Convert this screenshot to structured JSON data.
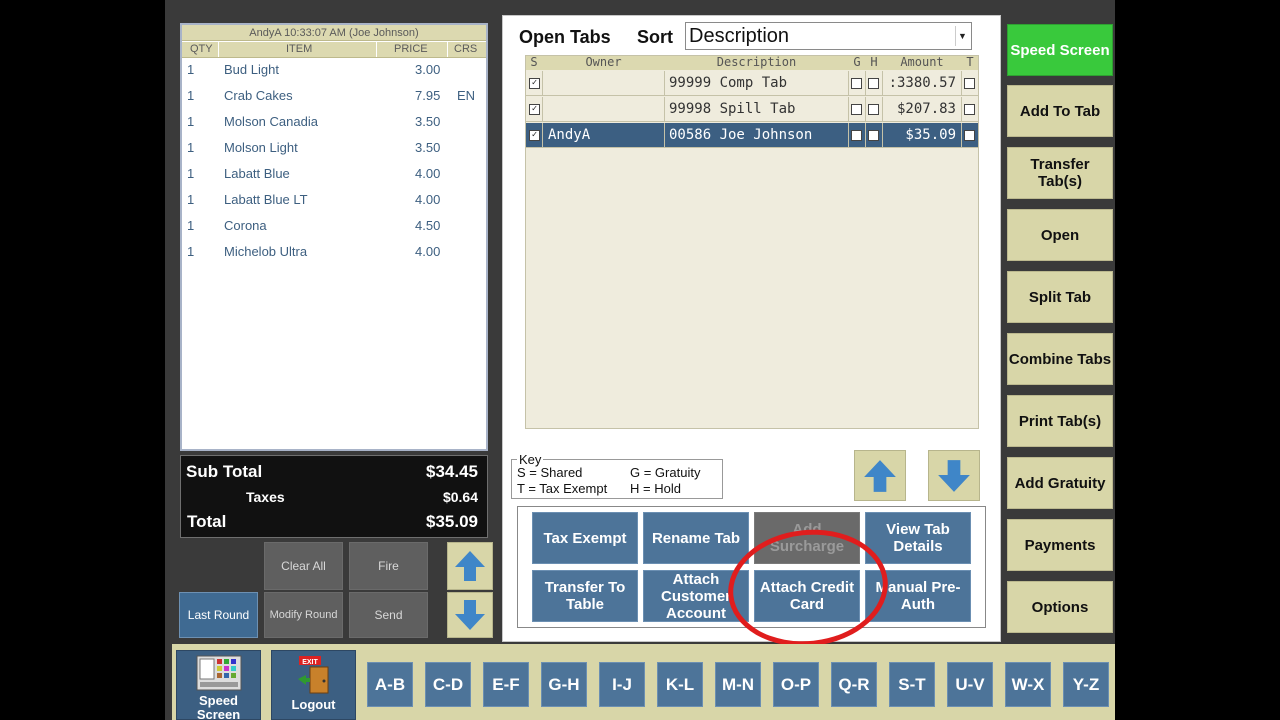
{
  "receipt": {
    "header": "AndyA  10:33:07 AM  (Joe Johnson)",
    "columns": {
      "qty": "QTY",
      "item": "ITEM",
      "price": "PRICE",
      "crs": "CRS"
    },
    "items": [
      {
        "qty": "1",
        "item": "Bud Light",
        "price": "3.00",
        "crs": ""
      },
      {
        "qty": "1",
        "item": "Crab Cakes",
        "price": "7.95",
        "crs": "EN"
      },
      {
        "qty": "1",
        "item": "Molson Canadia",
        "price": "3.50",
        "crs": ""
      },
      {
        "qty": "1",
        "item": "Molson Light",
        "price": "3.50",
        "crs": ""
      },
      {
        "qty": "1",
        "item": "Labatt Blue",
        "price": "4.00",
        "crs": ""
      },
      {
        "qty": "1",
        "item": "Labatt Blue LT",
        "price": "4.00",
        "crs": ""
      },
      {
        "qty": "1",
        "item": "Corona",
        "price": "4.50",
        "crs": ""
      },
      {
        "qty": "1",
        "item": "Michelob Ultra",
        "price": "4.00",
        "crs": ""
      }
    ]
  },
  "totals": {
    "subtotal_label": "Sub Total",
    "subtotal": "$34.45",
    "taxes_label": "Taxes",
    "taxes": "$0.64",
    "total_label": "Total",
    "total": "$35.09"
  },
  "round_buttons": {
    "clear_all": "Clear All",
    "fire": "Fire",
    "last_round": "Last Round",
    "modify_round": "Modify Round",
    "send": "Send"
  },
  "open_tabs": {
    "title": "Open Tabs",
    "sort_label": "Sort",
    "sort_value": "Description",
    "columns": {
      "s": "S",
      "owner": "Owner",
      "description": "Description",
      "g": "G",
      "h": "H",
      "amount": "Amount",
      "t": "T"
    },
    "rows": [
      {
        "shared": "✓",
        "owner": "",
        "description": "99999 Comp Tab",
        "amount": ":3380.57",
        "selected": false
      },
      {
        "shared": "✓",
        "owner": "",
        "description": "99998 Spill Tab",
        "amount": "$207.83",
        "selected": false
      },
      {
        "shared": "✓",
        "owner": "AndyA",
        "description": "00586 Joe Johnson",
        "amount": "$35.09",
        "selected": true
      }
    ]
  },
  "key": {
    "title": "Key",
    "shared": "S = Shared",
    "gratuity": "G = Gratuity",
    "tax_exempt": "T = Tax Exempt",
    "hold": "H = Hold"
  },
  "actions": {
    "tax_exempt": "Tax Exempt",
    "rename_tab": "Rename Tab",
    "add_surcharge": "Add Surcharge",
    "view_tab_details": "View Tab Details",
    "transfer_to_table": "Transfer To Table",
    "attach_customer_account": "Attach Customer Account",
    "attach_credit_card": "Attach Credit Card",
    "manual_preauth": "Manual Pre-Auth"
  },
  "right_menu": {
    "speed_screen": "Speed Screen",
    "add_to_tab": "Add To Tab",
    "transfer_tabs": "Transfer Tab(s)",
    "open": "Open",
    "split_tab": "Split Tab",
    "combine_tabs": "Combine Tabs",
    "print_tabs": "Print Tab(s)",
    "add_gratuity": "Add Gratuity",
    "payments": "Payments",
    "options": "Options"
  },
  "bottom": {
    "speed_screen": "Speed Screen",
    "logout": "Logout",
    "exit_sign": "EXIT",
    "letters": [
      "A-B",
      "C-D",
      "E-F",
      "G-H",
      "I-J",
      "K-L",
      "M-N",
      "O-P",
      "Q-R",
      "S-T",
      "U-V",
      "W-X",
      "Y-Z"
    ]
  },
  "colors": {
    "accent_blue": "#4d7499",
    "khaki": "#d8d6a8",
    "green": "#39c93c",
    "annotation_red": "#e01d1d"
  }
}
